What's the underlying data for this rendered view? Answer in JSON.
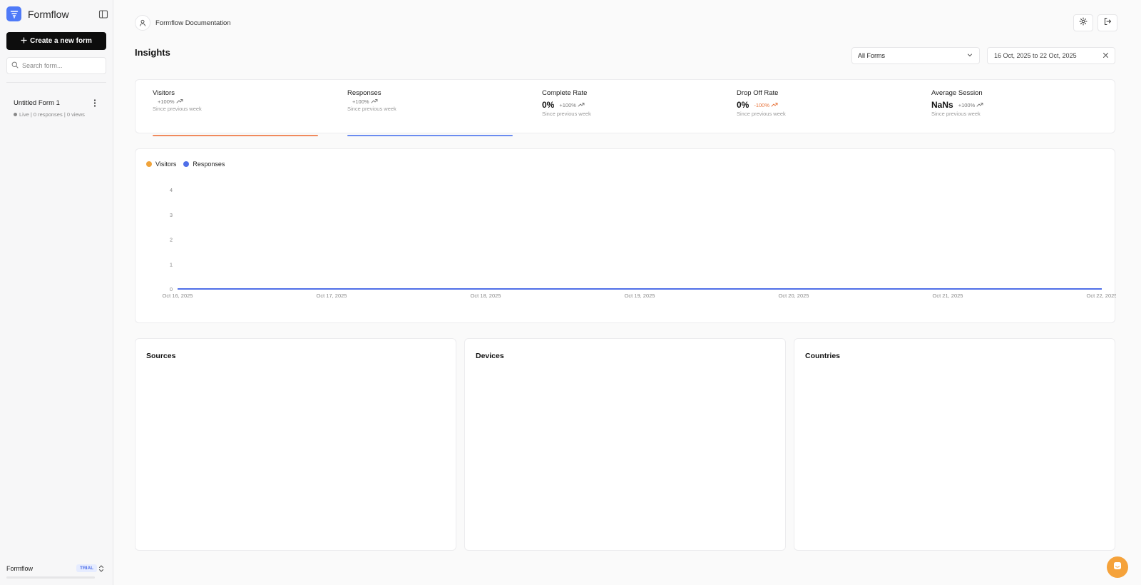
{
  "sidebar": {
    "brand_name": "Formflow",
    "create_button_label": "Create a new form",
    "search_placeholder": "Search form...",
    "forms": [
      {
        "title": "Untitled Form 1",
        "meta": "Live | 0 responses | 0 views"
      }
    ],
    "workspace": {
      "name": "Formflow",
      "badge": "TRIAL"
    }
  },
  "header": {
    "user_name": "Formflow Documentation",
    "page_title": "Insights",
    "form_select_value": "All Forms",
    "date_range": "16 Oct, 2025 to 22 Oct, 2025"
  },
  "stats": [
    {
      "label": "Visitors",
      "value": "",
      "change": "+100%",
      "sub": "Since previous week",
      "color": "#f08a5d"
    },
    {
      "label": "Responses",
      "value": "",
      "change": "+100%",
      "sub": "Since previous week",
      "color": "#6b8cf0"
    },
    {
      "label": "Complete Rate",
      "value": "0%",
      "change": "+100%",
      "sub": "Since previous week",
      "color": ""
    },
    {
      "label": "Drop Off Rate",
      "value": "0%",
      "change": "-100%",
      "sub": "Since previous week",
      "color": ""
    },
    {
      "label": "Average Session",
      "value": "NaNs",
      "change": "+100%",
      "sub": "Since previous week",
      "color": ""
    }
  ],
  "chart_data": {
    "type": "line",
    "x": [
      "Oct 16, 2025",
      "Oct 17, 2025",
      "Oct 18, 2025",
      "Oct 19, 2025",
      "Oct 20, 2025",
      "Oct 21, 2025",
      "Oct 22, 2025"
    ],
    "series": [
      {
        "name": "Visitors",
        "values": [
          0,
          0,
          0,
          0,
          0,
          0,
          0
        ],
        "color": "#f0a33a"
      },
      {
        "name": "Responses",
        "values": [
          0,
          0,
          0,
          0,
          0,
          0,
          0
        ],
        "color": "#4f6fe8"
      }
    ],
    "yticks": [
      0,
      1,
      2,
      3,
      4
    ],
    "ylim": [
      0,
      4
    ],
    "title": "",
    "xlabel": "",
    "ylabel": "",
    "grid": false,
    "legend": "top-left"
  },
  "panels": {
    "sources_title": "Sources",
    "devices_title": "Devices",
    "countries_title": "Countries"
  },
  "colors": {
    "brand": "#4f7af8",
    "chat": "#f5a23a"
  }
}
